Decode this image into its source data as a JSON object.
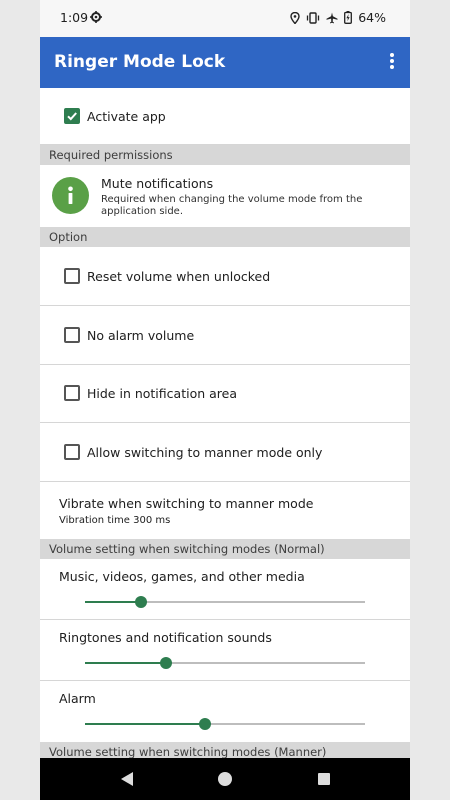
{
  "status_bar": {
    "time": "1:09",
    "battery": "64%",
    "icons": [
      "settings-gear-icon",
      "location-icon",
      "vibrate-icon",
      "airplane-icon",
      "battery-charging-icon"
    ]
  },
  "app_bar": {
    "title": "Ringer Mode Lock",
    "menu_icon": "more-vert-icon",
    "color": "#2f66c4"
  },
  "activate": {
    "label": "Activate app",
    "checked": true
  },
  "sections": {
    "permissions": "Required permissions",
    "option": "Option",
    "volume_normal": "Volume setting when switching modes (Normal)",
    "volume_manner": "Volume setting when switching modes (Manner)"
  },
  "permission": {
    "title": "Mute notifications",
    "description": "Required when changing the volume mode from the application side.",
    "icon": "info-icon"
  },
  "options": [
    {
      "label": "Reset volume when unlocked",
      "checked": false
    },
    {
      "label": "No alarm volume",
      "checked": false
    },
    {
      "label": "Hide in notification area",
      "checked": false
    },
    {
      "label": "Allow switching to manner mode only",
      "checked": false
    }
  ],
  "vibrate": {
    "title": "Vibrate when switching to manner mode",
    "description": "Vibration time 300 ms"
  },
  "volumes": [
    {
      "label": "Music, videos, games, and other media",
      "value": 0.2
    },
    {
      "label": "Ringtones and notification sounds",
      "value": 0.29
    },
    {
      "label": "Alarm",
      "value": 0.43
    }
  ],
  "accent_color": "#2e7d4f",
  "nav": [
    "back-icon",
    "home-icon",
    "recents-icon"
  ]
}
